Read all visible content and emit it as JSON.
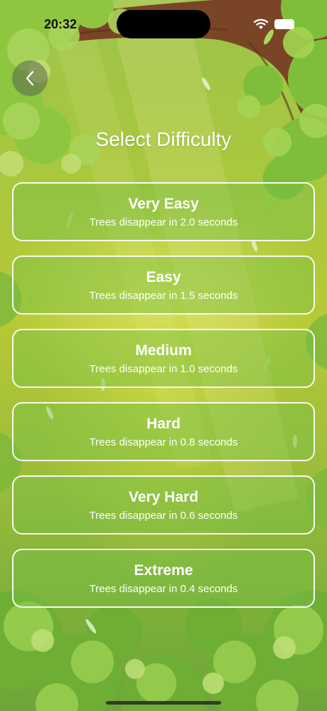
{
  "status_bar": {
    "time": "20:32",
    "wifi_icon": "wifi-icon",
    "battery_icon": "battery-icon"
  },
  "header": {
    "back_icon": "chevron-left-icon",
    "title": "Select Difficulty"
  },
  "difficulty_levels": [
    {
      "name": "Very Easy",
      "description": "Trees disappear in 2.0 seconds"
    },
    {
      "name": "Easy",
      "description": "Trees disappear in 1.5 seconds"
    },
    {
      "name": "Medium",
      "description": "Trees disappear in 1.0 seconds"
    },
    {
      "name": "Hard",
      "description": "Trees disappear in 0.8 seconds"
    },
    {
      "name": "Very Hard",
      "description": "Trees disappear in 0.6 seconds"
    },
    {
      "name": "Extreme",
      "description": "Trees disappear in 0.4 seconds"
    }
  ],
  "colors": {
    "card_border": "#ffffff",
    "card_fill": "#78be46",
    "background": "#a9c83e",
    "text": "#ffffff"
  }
}
